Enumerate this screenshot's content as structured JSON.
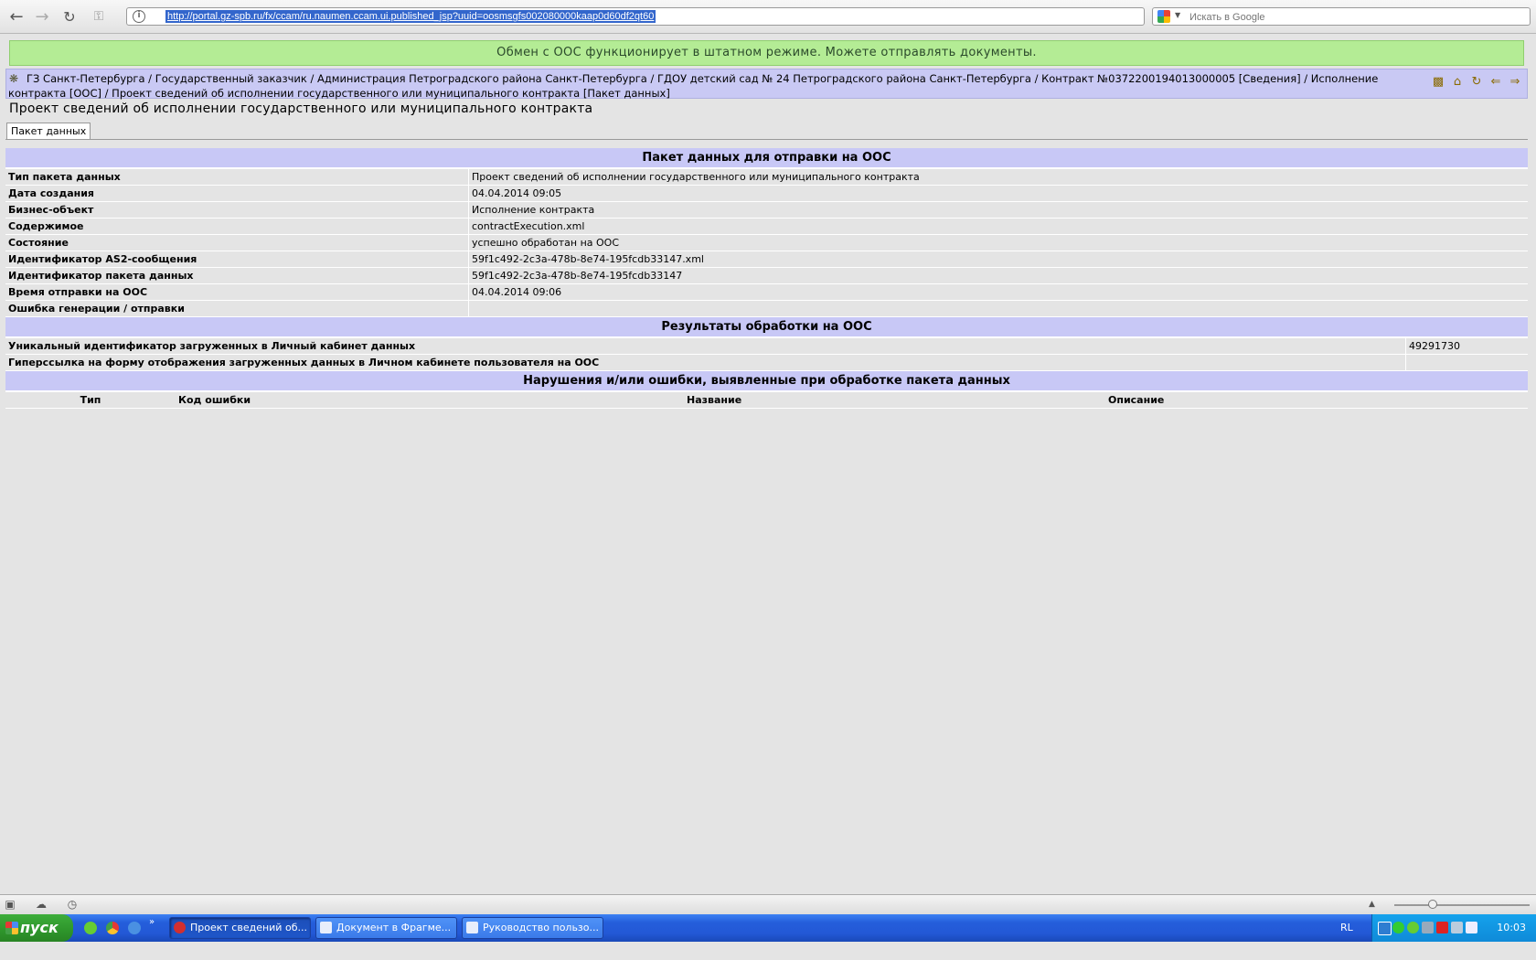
{
  "browser": {
    "url": "http://portal.gz-spb.ru/fx/ccam/ru.naumen.ccam.ui.published_jsp?uuid=oosmsgfs002080000kaap0d60df2qt60",
    "search_placeholder": "Искать в Google"
  },
  "banner": {
    "text": "Обмен с ООС функционирует в штатном режиме. Можете отправлять документы."
  },
  "breadcrumb": {
    "text": "ГЗ Санкт-Петербурга / Государственный заказчик / Администрация Петроградского района Санкт-Петербурга / ГДОУ детский сад № 24 Петроградского района Санкт-Петербурга / Контракт №0372200194013000005 [Сведения] / Исполнение контракта [ООС] / Проект сведений об исполнении государственного или муниципального контракта [Пакет данных]"
  },
  "page": {
    "title": "Проект сведений об исполнении государственного или муниципального контракта",
    "tab": "Пакет данных"
  },
  "package": {
    "heading": "Пакет данных для отправки на ООС",
    "rows": [
      {
        "key": "Тип пакета данных",
        "value": "Проект сведений об исполнении государственного или муниципального контракта"
      },
      {
        "key": "Дата создания",
        "value": "04.04.2014 09:05"
      },
      {
        "key": "Бизнес-объект",
        "value": "Исполнение контракта"
      },
      {
        "key": "Содержимое",
        "value": "contractExecution.xml"
      },
      {
        "key": "Состояние",
        "value": "успешно обработан на ООС"
      },
      {
        "key": "Идентификатор AS2-сообщения",
        "value": "59f1c492-2c3a-478b-8e74-195fcdb33147.xml"
      },
      {
        "key": "Идентификатор пакета данных",
        "value": "59f1c492-2c3a-478b-8e74-195fcdb33147"
      },
      {
        "key": "Время отправки на ООС",
        "value": "04.04.2014 09:06"
      },
      {
        "key": "Ошибка генерации / отправки",
        "value": ""
      }
    ]
  },
  "results": {
    "heading": "Результаты обработки на ООС",
    "rows": [
      {
        "key": "Уникальный идентификатор загруженных в Личный кабинет данных",
        "value": "49291730"
      },
      {
        "key": "Гиперссылка на форму отображения загруженных данных в Личном кабинете пользователя на ООС",
        "value": ""
      }
    ]
  },
  "errors": {
    "heading": "Нарушения и/или ошибки, выявленные при обработке пакета данных",
    "columns": [
      "Тип",
      "Код ошибки",
      "Название",
      "Описание"
    ]
  },
  "taskbar": {
    "start_label": "пуск",
    "tasks": [
      "Проект сведений об...",
      "Документ в Фрагме...",
      "Руководство пользо..."
    ],
    "language": "RL",
    "clock": "10:03"
  }
}
